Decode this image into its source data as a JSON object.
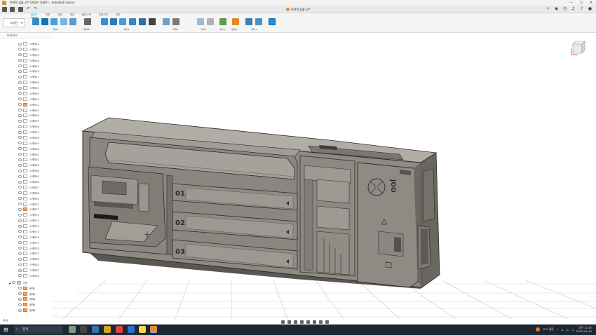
{
  "window": {
    "title": "혁혁혁 심볼 v5* (비대기 업데트) - Autodesk Fusion",
    "doc_tab": "혁혁혁 심볼 v5*",
    "controls": [
      "−",
      "□",
      "×"
    ]
  },
  "quick_access": {
    "undo": "↶",
    "redo": "↷"
  },
  "ribbon": {
    "workspace": "디자인",
    "tabs": [
      {
        "label": "솔리드",
        "active": true
      },
      {
        "label": "곡면",
        "active": false
      },
      {
        "label": "메쉬",
        "active": false
      },
      {
        "label": "판금",
        "active": false
      },
      {
        "label": "플라스틱",
        "active": false
      },
      {
        "label": "유틸리티",
        "active": false
      },
      {
        "label": "관리",
        "active": false
      }
    ],
    "groups": [
      "작성 ▾",
      "자동화 ▾",
      "수정 ▾",
      "조립 ▾",
      "구성 ▾",
      "검사 ▾",
      "삽입 ▾",
      "선택 ▾"
    ]
  },
  "browser": {
    "header": "브라우저",
    "bodies": [
      "스케치41",
      "스케치42",
      "스케치43",
      "스케치44",
      "스케치45",
      "스케치46",
      "스케치47",
      "스케치48",
      "스케치49",
      "스케치50",
      "스케치51",
      "스케치52",
      "스케치53",
      "스케치54",
      "스케치55",
      "스케치56",
      "스케치57",
      "스케치58",
      "스케치59",
      "스케치60",
      "스케치61",
      "스케치62",
      "스케치63",
      "스케치64",
      "스케치65",
      "스케치66",
      "스케치67",
      "스케치68",
      "스케치69",
      "스케치70",
      "스케치71",
      "스케치72",
      "스케치73",
      "스케치74",
      "스케치75",
      "스케치76",
      "스케치77",
      "스케치78",
      "스케치79",
      "스케치80",
      "스케치81",
      "스케치82",
      "스케치83"
    ],
    "folder": "본문",
    "folder_items": [
      "몸체1",
      "몸체2",
      "몸체3",
      "몸체4",
      "몸체5"
    ]
  },
  "model": {
    "labels": [
      "01",
      "02",
      "03"
    ],
    "side_text": "JOO",
    "colors": {
      "body": "#8e8a83",
      "dark": "#5f5c57",
      "light": "#a8a49d",
      "edge": "#2e2c2a"
    }
  },
  "bottom": {
    "comments": "주석",
    "search": "검색",
    "weather": "8°C 맑음",
    "time": "오전 11:45",
    "date": "2025-01-09"
  },
  "colors": {
    "accent": "#0696d7",
    "taskbar": "#1d2633"
  }
}
